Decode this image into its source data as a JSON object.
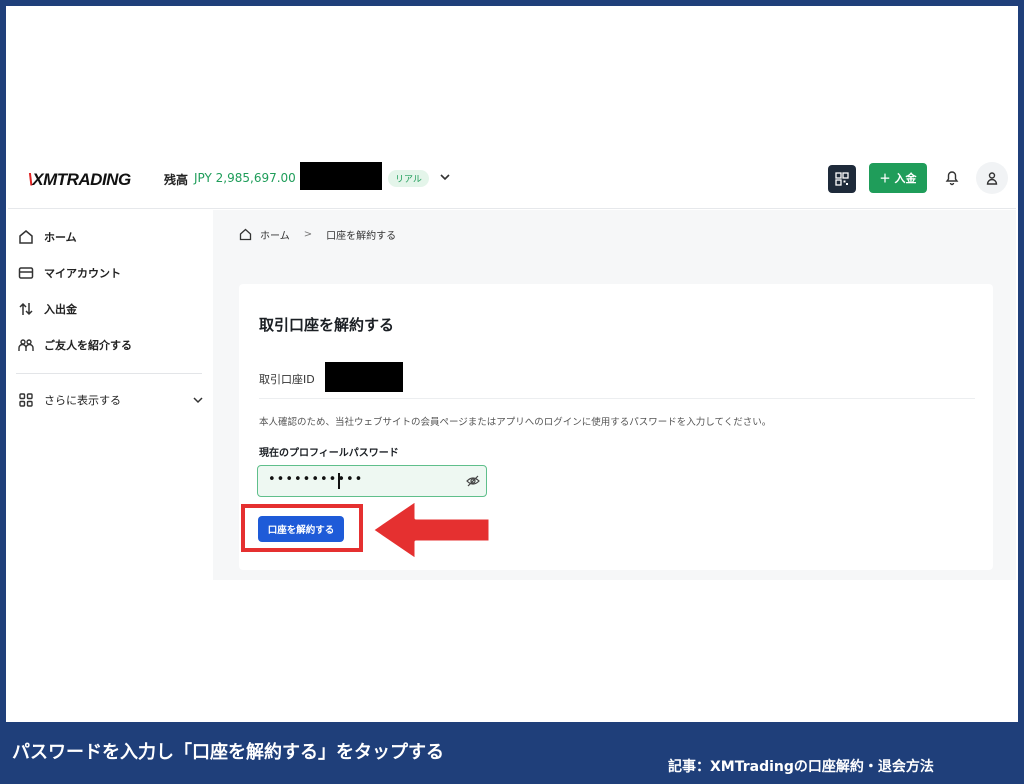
{
  "header": {
    "logo_x": "\\",
    "logo_text": "XMTRADING",
    "balance_label": "残高",
    "balance_value": "JPY 2,985,697.00",
    "account_badge": "リアル",
    "deposit_label": "入金",
    "deposit_icon": "plus-icon"
  },
  "sidebar": {
    "items": [
      {
        "label": "ホーム",
        "icon": "home-icon"
      },
      {
        "label": "マイアカウント",
        "icon": "account-card-icon"
      },
      {
        "label": "入出金",
        "icon": "transfer-arrows-icon"
      },
      {
        "label": "ご友人を紹介する",
        "icon": "people-icon"
      }
    ],
    "more_label": "さらに表示する"
  },
  "breadcrumb": {
    "home": "ホーム",
    "separator": ">",
    "current": "口座を解約する"
  },
  "card": {
    "title": "取引口座を解約する",
    "account_id_label": "取引口座ID",
    "note": "本人確認のため、当社ウェブサイトの会員ページまたはアプリへのログインに使用するパスワードを入力してください。",
    "password_label": "現在のプロフィールパスワード",
    "password_value": "•••••••••••",
    "close_button": "口座を解約する"
  },
  "caption": {
    "left": "パスワードを入力し「口座を解約する」をタップする",
    "right": "記事：XMTradingの口座解約・退会方法"
  },
  "colors": {
    "frame_border": "#1f3f7a",
    "accent_green": "#1f9d5a",
    "primary_blue": "#1e5bd8",
    "highlight_red": "#e53030"
  }
}
